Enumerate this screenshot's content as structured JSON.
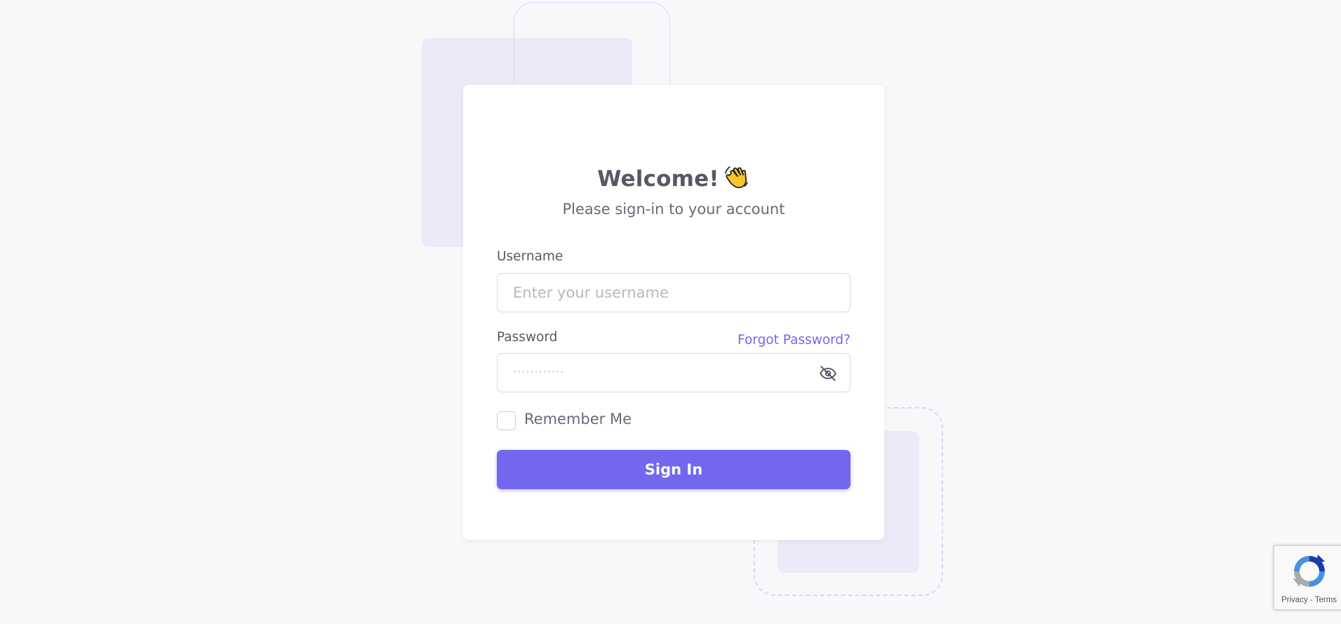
{
  "login": {
    "title": "Welcome!",
    "title_icon": "waving-hand-icon",
    "subtitle": "Please sign-in to your account",
    "username": {
      "label": "Username",
      "placeholder": "Enter your username",
      "value": ""
    },
    "password": {
      "label": "Password",
      "placeholder": "············",
      "value": "",
      "toggle_icon": "eye-off-icon"
    },
    "forgot_password_label": "Forgot Password?",
    "remember_me": {
      "label": "Remember Me",
      "checked": false
    },
    "sign_in_label": "Sign In"
  },
  "recaptcha": {
    "privacy_label": "Privacy",
    "separator": " - ",
    "terms_label": "Terms"
  },
  "colors": {
    "primary": "#7367f0",
    "background": "#f8f8fa",
    "card": "#ffffff",
    "decorative": "#eceaf8"
  }
}
